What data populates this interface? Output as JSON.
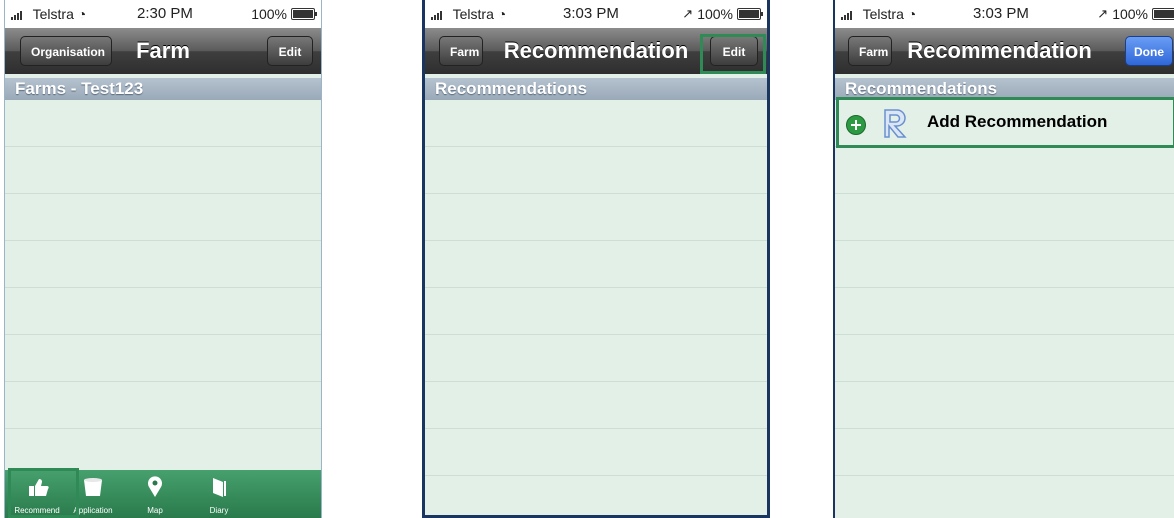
{
  "screens": [
    {
      "status": {
        "carrier": "Telstra",
        "time": "2:30 PM",
        "battery": "100%"
      },
      "nav": {
        "back_label": "Organisation",
        "title": "Farm",
        "right_label": "Edit"
      },
      "section_header": "Farms - Test123",
      "tabbar": {
        "items": [
          {
            "label": "Recommend",
            "icon": "thumbs-up-icon"
          },
          {
            "label": "Application",
            "icon": "bucket-icon"
          },
          {
            "label": "Map",
            "icon": "map-pin-icon"
          },
          {
            "label": "Diary",
            "icon": "book-icon"
          }
        ]
      }
    },
    {
      "status": {
        "carrier": "Telstra",
        "time": "3:03 PM",
        "battery": "100%"
      },
      "nav": {
        "back_label": "Farm",
        "title": "Recommendation",
        "right_label": "Edit"
      },
      "section_header": "Recommendations"
    },
    {
      "status": {
        "carrier": "Telstra",
        "time": "3:03 PM",
        "battery": "100%"
      },
      "nav": {
        "back_label": "Farm",
        "title": "Recommendation",
        "right_label": "Done"
      },
      "section_header": "Recommendations",
      "add_row": {
        "label": "Add Recommendation",
        "icon": "recommendation-r-icon"
      }
    }
  ],
  "colors": {
    "highlight": "#2f8a56",
    "done_button": "#3b77e6",
    "list_background": "#e2f0e7",
    "tabbar": "#2a7a4c"
  }
}
